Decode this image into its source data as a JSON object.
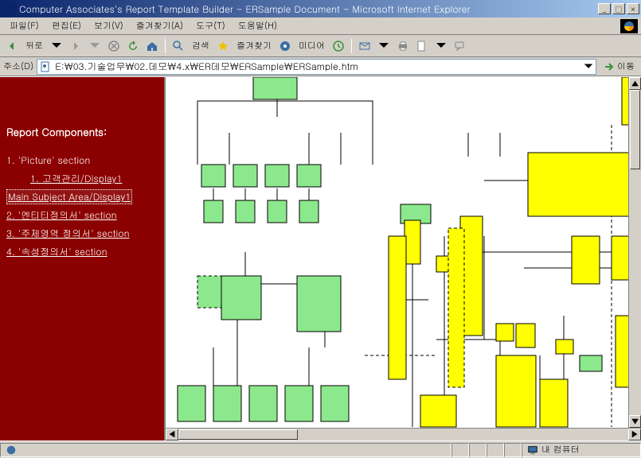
{
  "window": {
    "title": "Computer Associates's Report Template Builder - ERSample Document - Microsoft Internet Explorer"
  },
  "menu": {
    "file": "파일(F)",
    "edit": "편집(E)",
    "view": "보기(V)",
    "favorites": "즐겨찾기(A)",
    "tools": "도구(T)",
    "help": "도움말(H)"
  },
  "toolbar": {
    "back": "뒤로",
    "search": "검색",
    "favorites": "즐겨찾기",
    "media": "미디어"
  },
  "address": {
    "label": "주소(D)",
    "value": "E:\\03.기술업무\\02.데모\\4.x\\ER데모\\ERSample\\ERSample.htm",
    "go": "이동"
  },
  "sidebar": {
    "header": "Report Components:",
    "items": [
      {
        "label": "1. 'Picture' section",
        "link": false
      },
      {
        "label": "1. 고객관리/Display1",
        "link": true,
        "indent": true
      },
      {
        "label": "Main Subject Area/Display1",
        "link": true,
        "selected": true
      },
      {
        "label": "2. '엔티티정의서' section",
        "link": true
      },
      {
        "label": "3. '주제영역 정의서' section",
        "link": true
      },
      {
        "label": "4. '속성정의서' section",
        "link": true
      }
    ]
  },
  "status": {
    "left": "",
    "zone": "내 컴퓨터"
  }
}
